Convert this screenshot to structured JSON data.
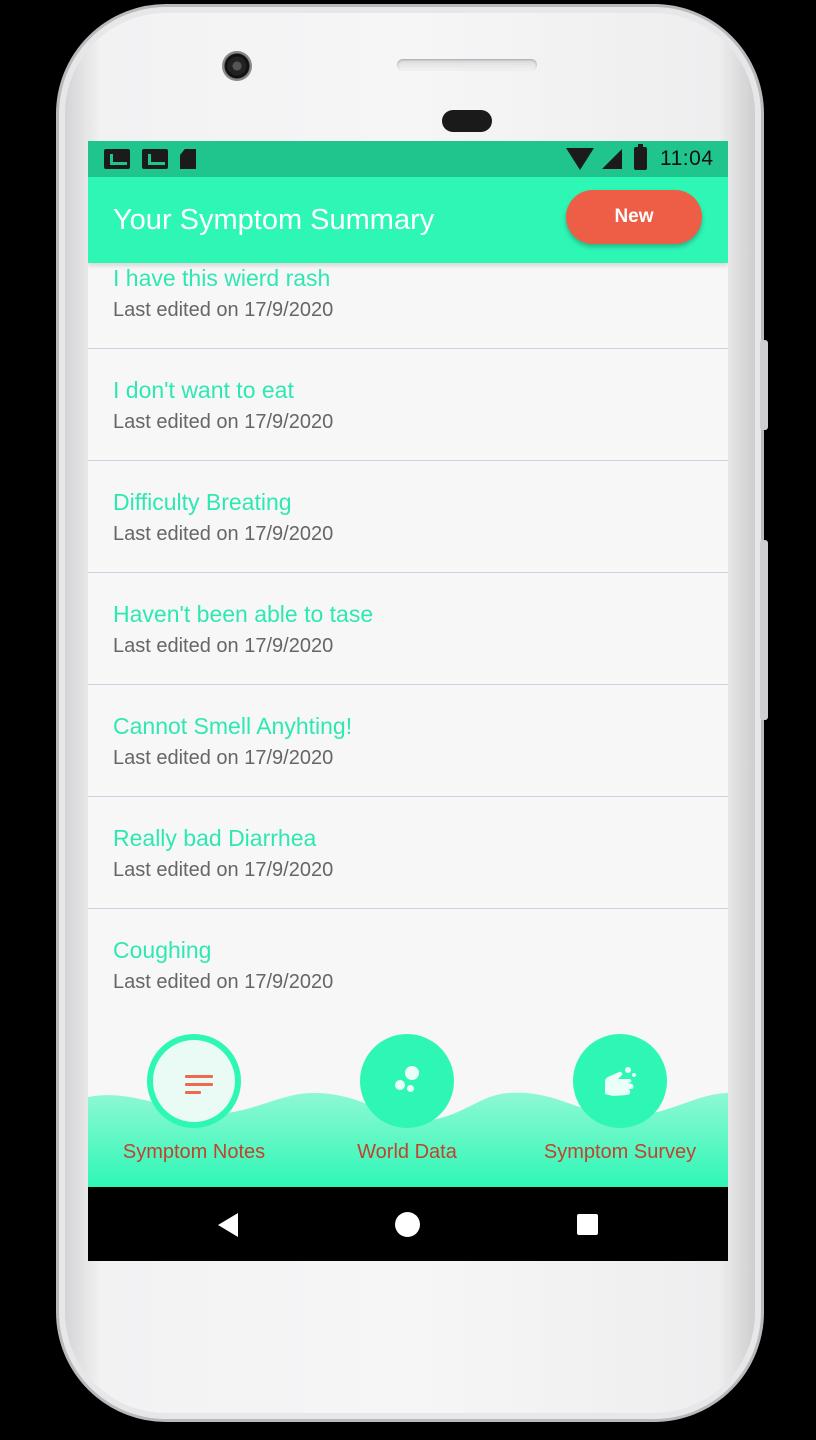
{
  "status_bar": {
    "time": "11:04",
    "icons": [
      "gmail-icon",
      "gmail-icon",
      "sd-card-icon",
      "wifi-icon",
      "signal-icon",
      "battery-charging-icon"
    ]
  },
  "app_bar": {
    "title": "Your Symptom Summary",
    "new_button_label": "New"
  },
  "notes": [
    {
      "title": "I have this wierd rash",
      "subtitle": "Last edited on 17/9/2020"
    },
    {
      "title": "I don't want to eat",
      "subtitle": "Last edited on 17/9/2020"
    },
    {
      "title": "Difficulty Breating",
      "subtitle": "Last edited on 17/9/2020"
    },
    {
      "title": "Haven't been able to tase",
      "subtitle": "Last edited on 17/9/2020"
    },
    {
      "title": "Cannot Smell Anyhting!",
      "subtitle": "Last edited on 17/9/2020"
    },
    {
      "title": "Really bad Diarrhea",
      "subtitle": "Last edited on 17/9/2020"
    },
    {
      "title": "Coughing",
      "subtitle": "Last edited on 17/9/2020"
    }
  ],
  "bottom_nav": {
    "items": [
      {
        "label": "Symptom Notes",
        "icon": "notes-icon",
        "active": true
      },
      {
        "label": "World Data",
        "icon": "bubbles-icon",
        "active": false
      },
      {
        "label": "Symptom Survey",
        "icon": "hand-wash-icon",
        "active": false
      }
    ]
  },
  "colors": {
    "accent": "#2ef7b6",
    "status_bar": "#1fc58c",
    "new_button": "#ee5e46",
    "nav_label": "#c0442c",
    "note_title": "#2ee8b4"
  }
}
